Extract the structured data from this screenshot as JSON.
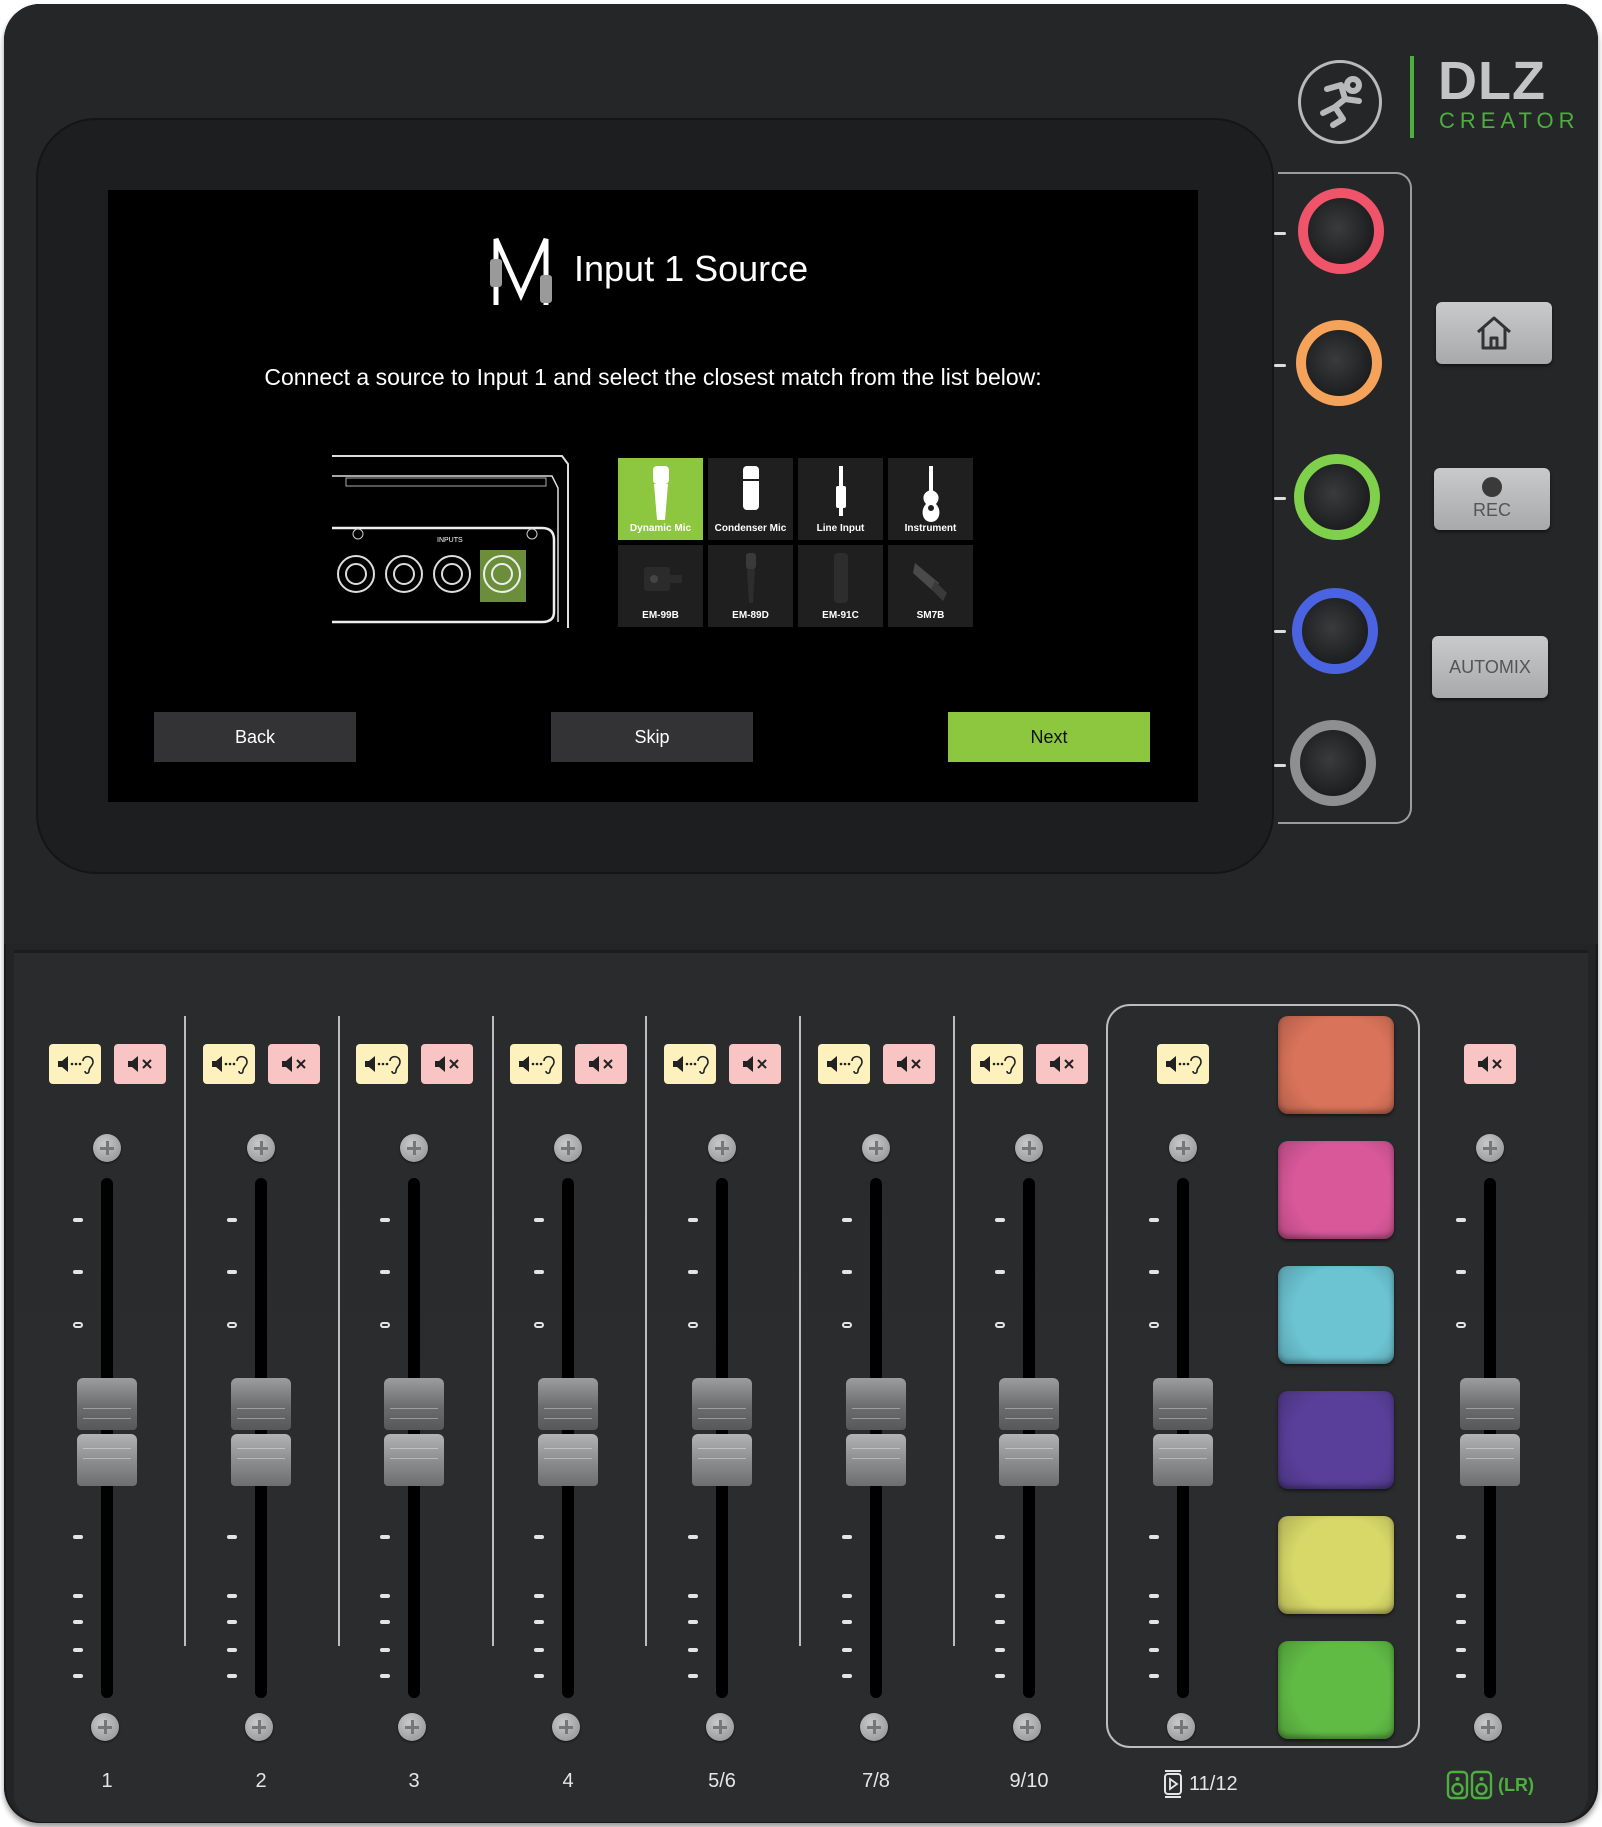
{
  "device": {
    "brand": "DLZ",
    "model": "CREATOR",
    "accent_color": "#4caf3e"
  },
  "screen": {
    "title": "Input 1 Source",
    "instruction": "Connect a source to Input 1 and select the closest match from the list below:",
    "diagram": {
      "label": "INPUTS",
      "highlighted_input": 1
    },
    "sources": [
      {
        "label": "Dynamic Mic",
        "icon": "dynamic-mic-icon",
        "selected": true
      },
      {
        "label": "Condenser Mic",
        "icon": "condenser-mic-icon",
        "selected": false
      },
      {
        "label": "Line Input",
        "icon": "line-input-jack-icon",
        "selected": false
      },
      {
        "label": "Instrument",
        "icon": "guitar-icon",
        "selected": false
      },
      {
        "label": "EM-99B",
        "icon": "em-99b-mic-icon",
        "selected": false
      },
      {
        "label": "EM-89D",
        "icon": "em-89d-mic-icon",
        "selected": false
      },
      {
        "label": "EM-91C",
        "icon": "em-91c-mic-icon",
        "selected": false
      },
      {
        "label": "SM7B",
        "icon": "sm7b-mic-icon",
        "selected": false
      }
    ],
    "buttons": {
      "back": "Back",
      "skip": "Skip",
      "next": "Next"
    },
    "selected_color": "#8dc63f"
  },
  "knobs": [
    {
      "name": "knob-1",
      "color": "#f0546a"
    },
    {
      "name": "knob-2",
      "color": "#f5a35a"
    },
    {
      "name": "knob-3",
      "color": "#7fd14b"
    },
    {
      "name": "knob-4",
      "color": "#4a63e0"
    },
    {
      "name": "knob-5",
      "color": "#8e8f91"
    }
  ],
  "side_buttons": {
    "home": "home-icon",
    "rec": "REC",
    "automix": "AUTOMIX"
  },
  "channels": [
    {
      "label": "1",
      "pfl": true,
      "mute": true
    },
    {
      "label": "2",
      "pfl": true,
      "mute": true
    },
    {
      "label": "3",
      "pfl": true,
      "mute": true
    },
    {
      "label": "4",
      "pfl": true,
      "mute": true
    },
    {
      "label": "5/6",
      "pfl": true,
      "mute": true
    },
    {
      "label": "7/8",
      "pfl": true,
      "mute": true
    },
    {
      "label": "9/10",
      "pfl": true,
      "mute": true
    },
    {
      "label": "11/12",
      "pfl": true,
      "mute": false,
      "icon": "playback-icon"
    },
    {
      "label": "(LR)",
      "pfl": false,
      "mute": true,
      "icon": "monitor-speakers-icon"
    }
  ],
  "pads": [
    {
      "color": "#d9735a"
    },
    {
      "color": "#d9589a"
    },
    {
      "color": "#6cc3d2"
    },
    {
      "color": "#5a3f9a"
    },
    {
      "color": "#d7d868"
    },
    {
      "color": "#60bb45"
    }
  ]
}
